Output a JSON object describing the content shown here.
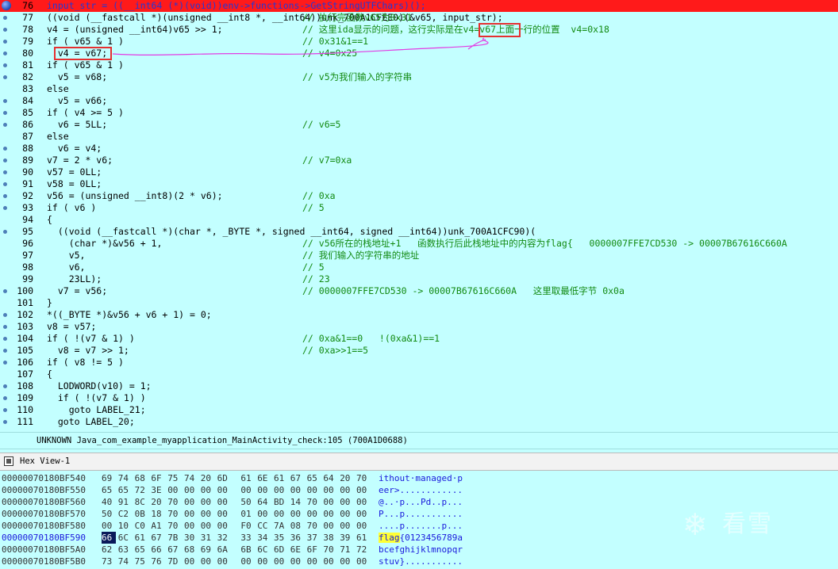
{
  "code_lines": [
    {
      "n": "76",
      "code": "input_str = ((__int64 (*)(void))env->functions->GetStringUTFChars)();",
      "comment": ""
    },
    {
      "n": "77",
      "code": "((void (__fastcall *)(unsigned __int8 *, __int64))unk_700A1CFEE0)(&v65, input_str);",
      "comment": "// 执行完函数v65为0x31"
    },
    {
      "n": "78",
      "code": "v4 = (unsigned __int64)v65 >> 1;",
      "comment": "// 这里ida显示的问题，这行实际是在v4=v67上面一行的位置  v4=0x18"
    },
    {
      "n": "79",
      "code": "if ( v65 & 1 )",
      "comment": "// 0x31&1==1"
    },
    {
      "n": "80",
      "code": "  v4 = v67;",
      "comment": "// v4=0x25"
    },
    {
      "n": "81",
      "code": "if ( v65 & 1 )",
      "comment": ""
    },
    {
      "n": "82",
      "code": "  v5 = v68;",
      "comment": "// v5为我们输入的字符串"
    },
    {
      "n": "83",
      "code": "else",
      "comment": ""
    },
    {
      "n": "84",
      "code": "  v5 = v66;",
      "comment": ""
    },
    {
      "n": "85",
      "code": "if ( v4 >= 5 )",
      "comment": ""
    },
    {
      "n": "86",
      "code": "  v6 = 5LL;",
      "comment": "// v6=5"
    },
    {
      "n": "87",
      "code": "else",
      "comment": ""
    },
    {
      "n": "88",
      "code": "  v6 = v4;",
      "comment": ""
    },
    {
      "n": "89",
      "code": "v7 = 2 * v6;",
      "comment": "// v7=0xa"
    },
    {
      "n": "90",
      "code": "v57 = 0LL;",
      "comment": ""
    },
    {
      "n": "91",
      "code": "v58 = 0LL;",
      "comment": ""
    },
    {
      "n": "92",
      "code": "v56 = (unsigned __int8)(2 * v6);",
      "comment": "// 0xa"
    },
    {
      "n": "93",
      "code": "if ( v6 )",
      "comment": "// 5"
    },
    {
      "n": "94",
      "code": "{",
      "comment": ""
    },
    {
      "n": "95",
      "code": "  ((void (__fastcall *)(char *, _BYTE *, signed __int64, signed __int64))unk_700A1CFC90)(",
      "comment": ""
    },
    {
      "n": "96",
      "code": "    (char *)&v56 + 1,",
      "comment": "// v56所在的栈地址+1   函数执行后此栈地址中的内容为flag{   0000007FFE7CD530 -> 00007B67616C660A"
    },
    {
      "n": "97",
      "code": "    v5,",
      "comment": "// 我们输入的字符串的地址"
    },
    {
      "n": "98",
      "code": "    v6,",
      "comment": "// 5"
    },
    {
      "n": "99",
      "code": "    23LL);",
      "comment": "// 23"
    },
    {
      "n": "100",
      "code": "  v7 = v56;",
      "comment": "// 0000007FFE7CD530 -> 00007B67616C660A   这里取最低字节 0x0a"
    },
    {
      "n": "101",
      "code": "}",
      "comment": ""
    },
    {
      "n": "102",
      "code": "*((_BYTE *)&v56 + v6 + 1) = 0;",
      "comment": ""
    },
    {
      "n": "103",
      "code": "v8 = v57;",
      "comment": ""
    },
    {
      "n": "104",
      "code": "if ( !(v7 & 1) )",
      "comment": "// 0xa&1==0   !(0xa&1)==1"
    },
    {
      "n": "105",
      "code": "  v8 = v7 >> 1;",
      "comment": "// 0xa>>1==5"
    },
    {
      "n": "106",
      "code": "if ( v8 != 5 )",
      "comment": ""
    },
    {
      "n": "107",
      "code": "{",
      "comment": ""
    },
    {
      "n": "108",
      "code": "  LODWORD(v10) = 1;",
      "comment": ""
    },
    {
      "n": "109",
      "code": "  if ( !(v7 & 1) )",
      "comment": ""
    },
    {
      "n": "110",
      "code": "    goto LABEL_21;",
      "comment": ""
    },
    {
      "n": "111",
      "code": "  goto LABEL_20;",
      "comment": ""
    }
  ],
  "status_bar": "UNKNOWN Java_com_example_myapplication_MainActivity_check:105 (700A1D0688)",
  "hex_view_title": "Hex View-1",
  "hex_rows": [
    {
      "addr": "00000070180BF540",
      "bytes": [
        "69",
        "74",
        "68",
        "6F",
        "75",
        "74",
        "20",
        "6D",
        "61",
        "6E",
        "61",
        "67",
        "65",
        "64",
        "20",
        "70"
      ],
      "ascii": "ithout·managed·p"
    },
    {
      "addr": "00000070180BF550",
      "bytes": [
        "65",
        "65",
        "72",
        "3E",
        "00",
        "00",
        "00",
        "00",
        "00",
        "00",
        "00",
        "00",
        "00",
        "00",
        "00",
        "00"
      ],
      "ascii": "eer>............"
    },
    {
      "addr": "00000070180BF560",
      "bytes": [
        "40",
        "91",
        "8C",
        "20",
        "70",
        "00",
        "00",
        "00",
        "50",
        "64",
        "BD",
        "14",
        "70",
        "00",
        "00",
        "00"
      ],
      "ascii": "@..·p...Pd..p..."
    },
    {
      "addr": "00000070180BF570",
      "bytes": [
        "50",
        "C2",
        "0B",
        "18",
        "70",
        "00",
        "00",
        "00",
        "01",
        "00",
        "00",
        "00",
        "00",
        "00",
        "00",
        "00"
      ],
      "ascii": "P...p..........."
    },
    {
      "addr": "00000070180BF580",
      "bytes": [
        "00",
        "10",
        "C0",
        "A1",
        "70",
        "00",
        "00",
        "00",
        "F0",
        "CC",
        "7A",
        "08",
        "70",
        "00",
        "00",
        "00"
      ],
      "ascii": "....p.......p..."
    },
    {
      "addr": "00000070180BF590",
      "bytes": [
        "66",
        "6C",
        "61",
        "67",
        "7B",
        "30",
        "31",
        "32",
        "33",
        "34",
        "35",
        "36",
        "37",
        "38",
        "39",
        "61"
      ],
      "ascii_pre": "flag",
      "ascii": "{0123456789a"
    },
    {
      "addr": "00000070180BF5A0",
      "bytes": [
        "62",
        "63",
        "65",
        "66",
        "67",
        "68",
        "69",
        "6A",
        "6B",
        "6C",
        "6D",
        "6E",
        "6F",
        "70",
        "71",
        "72"
      ],
      "ascii": "bcefghijklmnopqr"
    },
    {
      "addr": "00000070180BF5B0",
      "bytes": [
        "73",
        "74",
        "75",
        "76",
        "7D",
        "00",
        "00",
        "00",
        "00",
        "00",
        "00",
        "00",
        "00",
        "00",
        "00",
        "00"
      ],
      "ascii": "stuv}..........."
    }
  ],
  "watermark_text": "看雪",
  "colors": {
    "background": "#c3ffff",
    "breakpoint_line": "#ff1a1a",
    "comment": "#128a12",
    "highlight": "#ffff33"
  }
}
